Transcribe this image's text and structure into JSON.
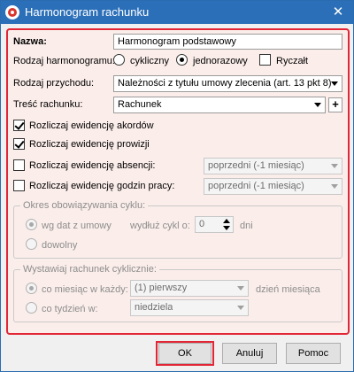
{
  "window": {
    "title": "Harmonogram rachunku",
    "close_symbol": "✕"
  },
  "colors": {
    "titlebar": "#2b6fb8",
    "form_background": "#fbeeea",
    "highlight_border": "#e32636"
  },
  "form": {
    "nazwa_label": "Nazwa:",
    "nazwa_value": "Harmonogram podstawowy",
    "rodzaj_harmonogramu_label": "Rodzaj harmonogramu:",
    "radio_cykliczny": "cykliczny",
    "radio_jednorazowy": "jednorazowy",
    "selected_rodzaj": "jednorazowy",
    "ryczalt_label": "Ryczałt",
    "ryczalt_checked": false,
    "rodzaj_przychodu_label": "Rodzaj przychodu:",
    "rodzaj_przychodu_value": "Należności z tytułu umowy zlecenia (art. 13 pkt 8)",
    "tresc_label": "Treść rachunku:",
    "tresc_value": "Rachunek",
    "plus_symbol": "+",
    "akordow_label": "Rozliczaj ewidencję akordów",
    "akordow_checked": true,
    "prowizji_label": "Rozliczaj ewidencję prowizji",
    "prowizji_checked": true,
    "absencji_label": "Rozliczaj ewidencję absencji:",
    "absencji_checked": false,
    "absencji_value": "poprzedni (-1 miesiąc)",
    "godzin_label": "Rozliczaj ewidencję godzin pracy:",
    "godzin_checked": false,
    "godzin_value": "poprzedni (-1 miesiąc)"
  },
  "okres_group": {
    "legend": "Okres obowiązywania cyklu:",
    "radio_wg_dat": "wg dat z umowy",
    "radio_dowolny": "dowolny",
    "selected": "wg dat z umowy",
    "wydluz_label": "wydłuż cykl o:",
    "wydluz_value": "0",
    "dni_label": "dni"
  },
  "wystawiaj_group": {
    "legend": "Wystawiaj rachunek cyklicznie:",
    "radio_co_miesiac": "co miesiąc w każdy:",
    "radio_co_tydzien": "co tydzień w:",
    "selected": "co miesiąc w każdy:",
    "miesiac_value": "(1) pierwszy",
    "dzien_miesiaca_label": "dzień miesiąca",
    "tydzien_value": "niedziela"
  },
  "buttons": {
    "ok": "OK",
    "anuluj": "Anuluj",
    "pomoc": "Pomoc"
  }
}
